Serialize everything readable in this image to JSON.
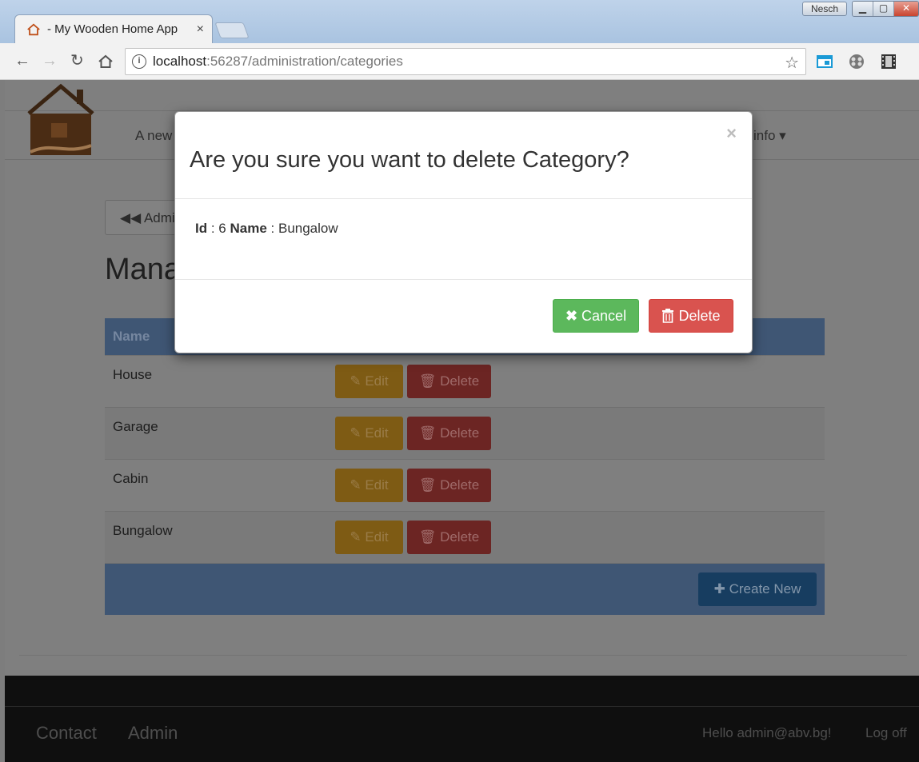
{
  "browser": {
    "tab_title": "- My Wooden Home App",
    "tab_close": "×",
    "user_chip": "Nesch",
    "url_host": "localhost",
    "url_rest": ":56287/administration/categories"
  },
  "header": {
    "nav_text": "A new",
    "info_menu": "info ▾"
  },
  "page": {
    "admin_button": "Admin",
    "title": "Mana",
    "table": {
      "column_name": "Name",
      "rows": [
        {
          "name": "House"
        },
        {
          "name": "Garage"
        },
        {
          "name": "Cabin"
        },
        {
          "name": "Bungalow"
        }
      ],
      "edit_label": "Edit",
      "delete_label": "Delete",
      "create_label": "Create New"
    }
  },
  "footer": {
    "contact": "Contact",
    "admin": "Admin",
    "hello": "Hello admin@abv.bg!",
    "logoff": "Log off"
  },
  "modal": {
    "close": "×",
    "title": "Are you sure you want to delete Category?",
    "id_label": "Id",
    "id_value": ": 6",
    "name_label": "Name",
    "name_value": ": Bungalow",
    "cancel_label": "Cancel",
    "delete_label": "Delete"
  },
  "colors": {
    "cancel": "#5cb85c",
    "delete": "#d9534f",
    "table_header": "#3f5674"
  }
}
